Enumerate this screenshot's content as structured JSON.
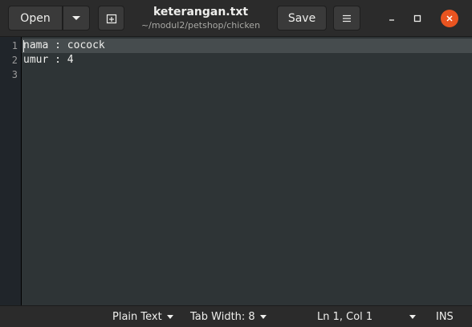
{
  "header": {
    "open_label": "Open",
    "title": "keterangan.txt",
    "subtitle": "~/modul2/petshop/chicken",
    "save_label": "Save"
  },
  "editor": {
    "lines": [
      {
        "number": "1",
        "text": "nama : cocock"
      },
      {
        "number": "2",
        "text": "umur : 4"
      },
      {
        "number": "3",
        "text": ""
      }
    ]
  },
  "statusbar": {
    "language": "Plain Text",
    "tab_width": "Tab Width: 8",
    "cursor_position": "Ln 1, Col 1",
    "insert_mode": "INS"
  },
  "colors": {
    "close_button": "#e95420",
    "editor_background": "#2e3436",
    "current_line": "#464c4e"
  },
  "icons": [
    "chevron-down-icon",
    "new-tab-icon",
    "hamburger-menu-icon",
    "minimize-icon",
    "maximize-icon",
    "close-icon"
  ]
}
